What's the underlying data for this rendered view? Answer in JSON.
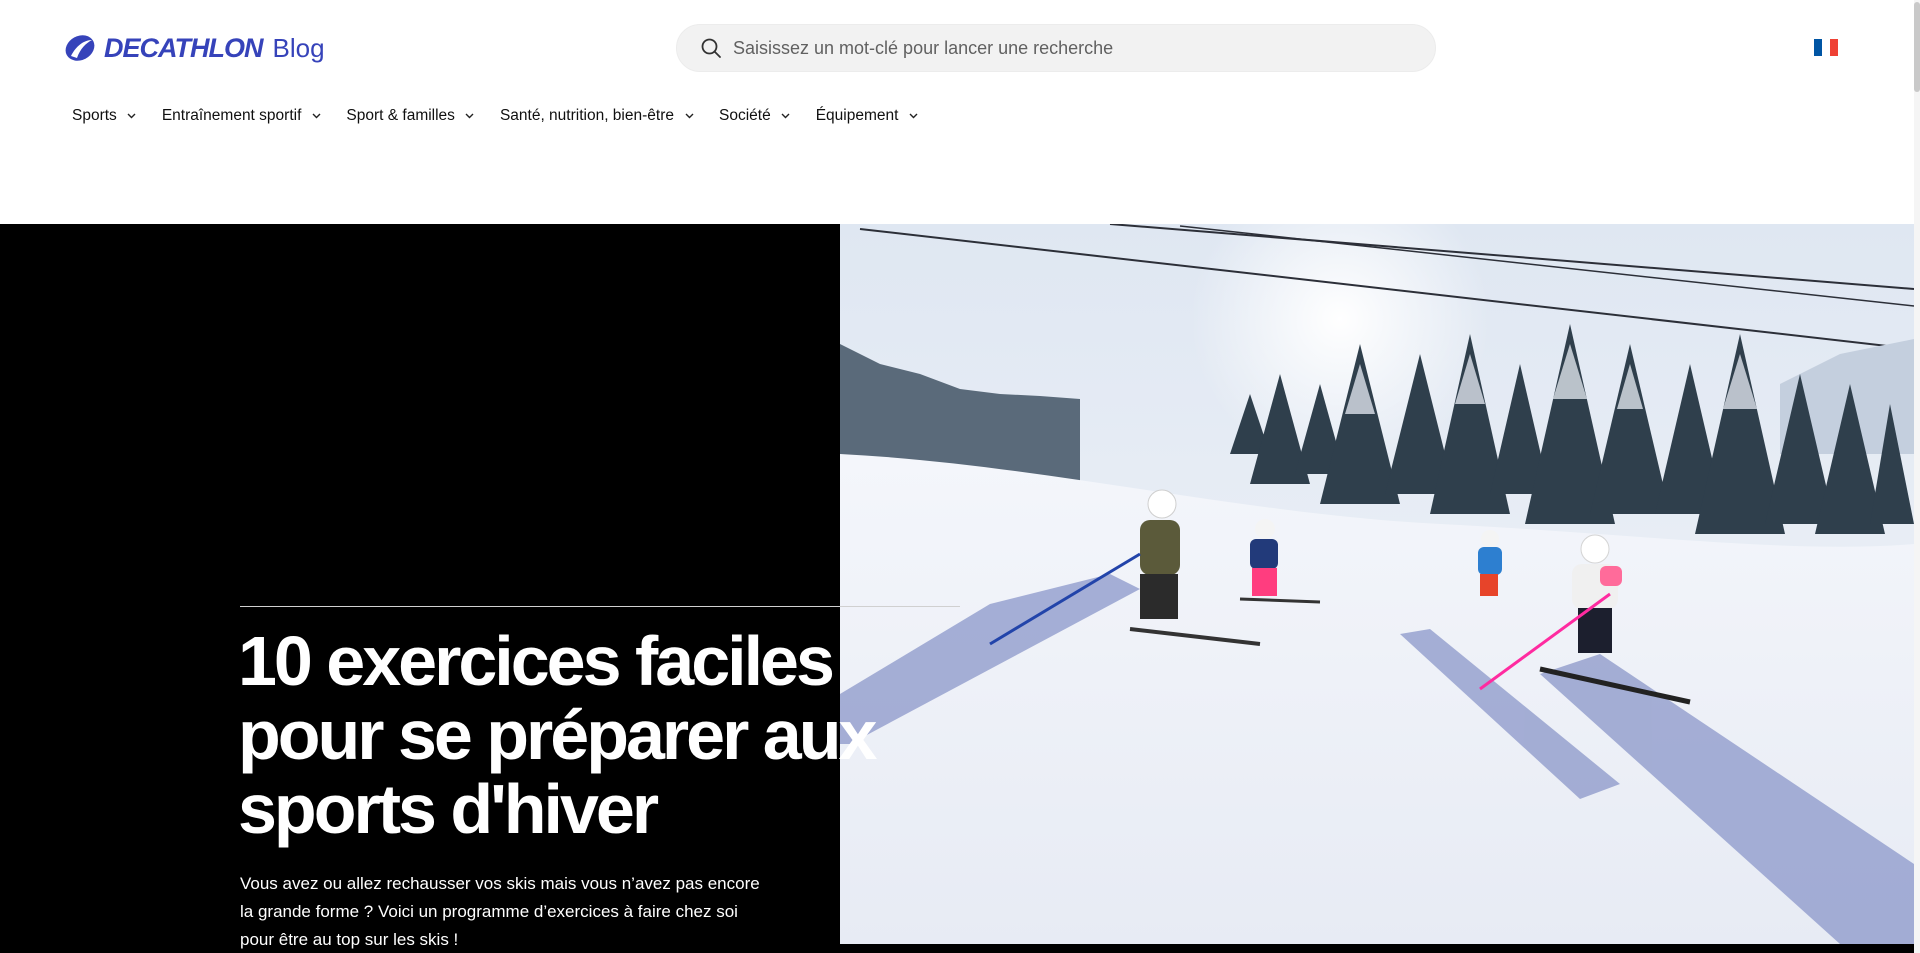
{
  "header": {
    "logo": {
      "brand": "DECATHLON",
      "sub": "Blog",
      "color": "#3643ba"
    },
    "search": {
      "placeholder": "Saisissez un mot-clé pour lancer une recherche",
      "value": "",
      "icon": "search-icon"
    },
    "language": {
      "icon": "france-flag-icon",
      "colors": [
        "#0055a4",
        "#ffffff",
        "#ef4135"
      ]
    }
  },
  "nav": {
    "items": [
      {
        "label": "Sports"
      },
      {
        "label": "Entraînement sportif"
      },
      {
        "label": "Sport & familles"
      },
      {
        "label": "Santé, nutrition, bien-être"
      },
      {
        "label": "Société"
      },
      {
        "label": "Équipement"
      }
    ]
  },
  "hero": {
    "title": "10 exercices faciles pour se préparer aux sports d'hiver",
    "description": "Vous avez ou allez rechausser vos skis mais vous n’avez pas encore la grande forme ? Voici un programme d’exercices à faire chez soi pour être au top sur les skis !",
    "image_subject": "family-skiing-photo"
  }
}
